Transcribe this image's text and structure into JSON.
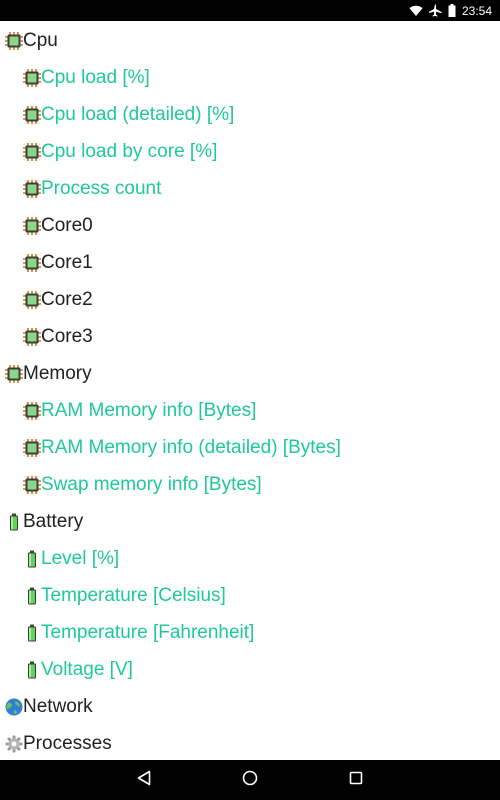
{
  "status_bar": {
    "time": "23:54",
    "icons": [
      "wifi-icon",
      "airplane-mode-icon",
      "battery-icon"
    ]
  },
  "tree": {
    "cpu": {
      "label": "Cpu",
      "icon": "chip-icon",
      "children": [
        {
          "label": "Cpu load [%]"
        },
        {
          "label": "Cpu load (detailed) [%]"
        },
        {
          "label": "Cpu load by core [%]"
        },
        {
          "label": "Process count"
        },
        {
          "label": "Core0"
        },
        {
          "label": "Core1"
        },
        {
          "label": "Core2"
        },
        {
          "label": "Core3"
        }
      ]
    },
    "memory": {
      "label": "Memory",
      "icon": "chip-icon",
      "children": [
        {
          "label": "RAM Memory info [Bytes]"
        },
        {
          "label": "RAM Memory info (detailed) [Bytes]"
        },
        {
          "label": "Swap memory info [Bytes]"
        }
      ]
    },
    "battery": {
      "label": "Battery",
      "icon": "battery-icon",
      "children": [
        {
          "label": "Level [%]"
        },
        {
          "label": "Temperature [Celsius]"
        },
        {
          "label": "Temperature [Fahrenheit]"
        },
        {
          "label": "Voltage [V]"
        }
      ]
    },
    "network": {
      "label": "Network",
      "icon": "globe-icon"
    },
    "processes": {
      "label": "Processes",
      "icon": "gear-icon"
    }
  },
  "nav_bar": {
    "buttons": [
      "back-icon",
      "home-icon",
      "recents-icon"
    ]
  },
  "colors": {
    "child_text": "#1ec99a",
    "parent_text": "#212121",
    "bars": "#000000"
  }
}
